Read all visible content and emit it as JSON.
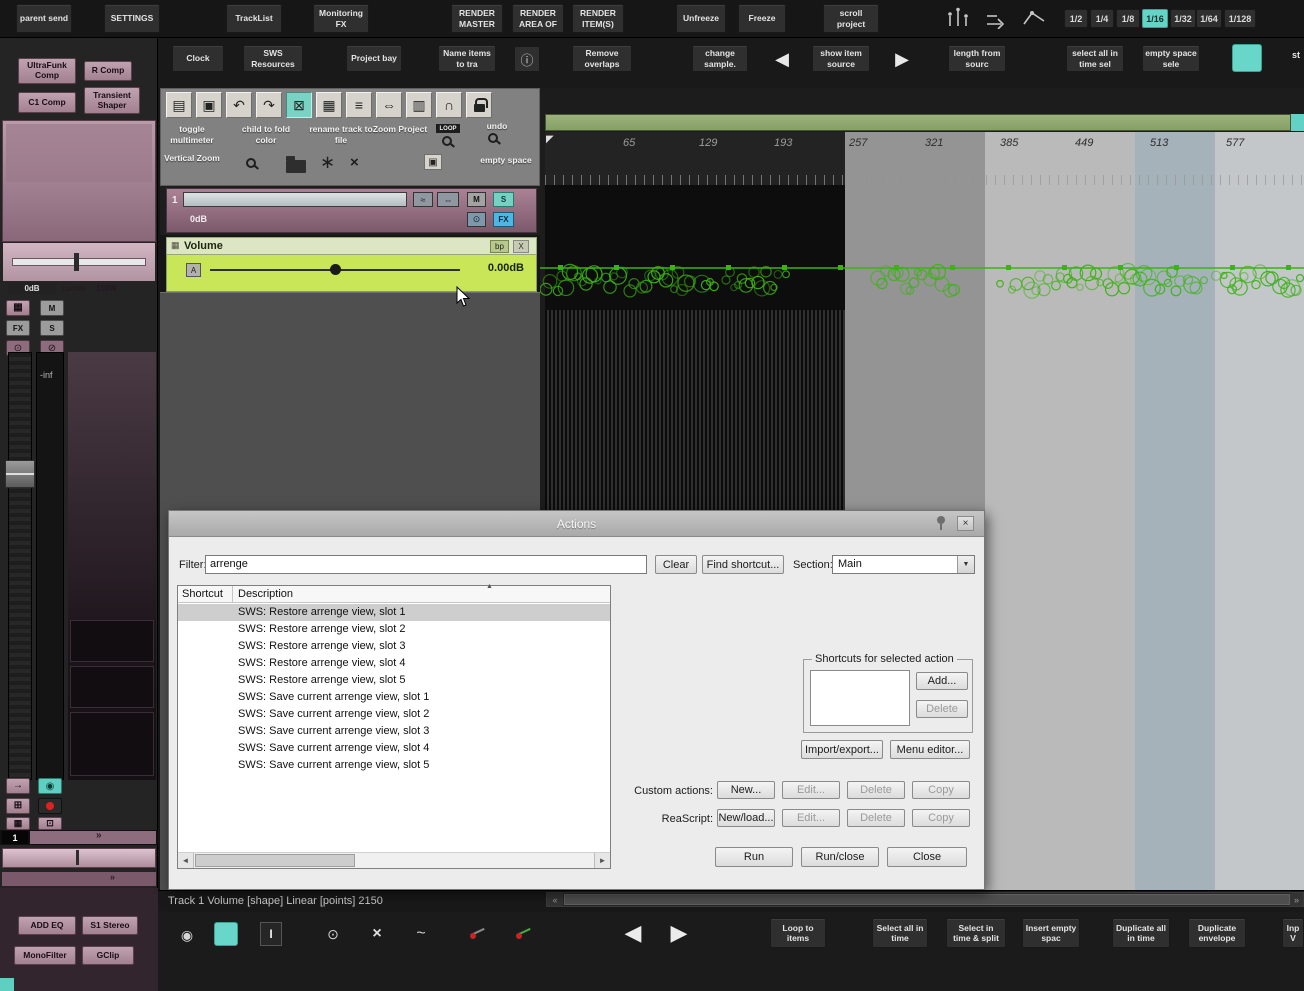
{
  "colors": {
    "accent_teal": "#67d3c6",
    "waveform_green": "#3cb313",
    "envelope_yellow_green": "#c9e558",
    "mixer_pink": "#b193a1"
  },
  "top_toolbar": {
    "buttons": [
      "parent send",
      "SETTINGS",
      "TrackList",
      "Monitoring FX",
      "RENDER MASTER",
      "RENDER AREA OF",
      "RENDER ITEM(S)",
      "Unfreeze",
      "Freeze",
      "scroll project"
    ],
    "grid_divisions": [
      "1/2",
      "1/4",
      "1/8",
      "1/16",
      "1/32",
      "1/64",
      "1/128"
    ],
    "active_division": "1/16"
  },
  "toolbar2": {
    "buttons": [
      "Clock",
      "SWS Resources",
      "Project bay",
      "Name items to tra",
      "Remove overlaps",
      "change sample.",
      "show item source",
      "length from sourc",
      "select all in time sel",
      "empty space sele"
    ],
    "partial_right": "st"
  },
  "mixer": {
    "fx_top": [
      "UltraFunk Comp",
      "R Comp",
      "C1 Comp",
      "Transient Shaper"
    ],
    "volume": "0dB",
    "pan": "center",
    "width": "100W",
    "mute": "M",
    "solo": "S",
    "fx": "FX",
    "meter": "-inf",
    "track_number": "1",
    "more": "»",
    "fx_bottom": [
      "ADD EQ",
      "S1 Stereo",
      "MonoFilter",
      "GClip"
    ]
  },
  "mid_toolbar": {
    "labels": [
      "toggle multimeter",
      "child to fold color",
      "rename track to file",
      "Zoom Project"
    ],
    "loop_label": "LOOP",
    "undo_label": "undo",
    "vertical_zoom": "Vertical Zoom",
    "empty_space": "empty space"
  },
  "track_panel": {
    "number": "1",
    "volume": "0dB",
    "mute": "M",
    "solo": "S",
    "fx": "FX"
  },
  "envelope_panel": {
    "title": "Volume",
    "bypass": "bp",
    "close": "X",
    "mode": "A",
    "value": "0.00dB"
  },
  "timeline": {
    "ruler_ticks": [
      "65",
      "129",
      "193",
      "257",
      "321",
      "385",
      "449",
      "513",
      "577"
    ]
  },
  "actions_dialog": {
    "title": "Actions",
    "filter_label": "Filter:",
    "filter_value": "arrenge",
    "clear_button": "Clear",
    "find_shortcut_button": "Find shortcut...",
    "section_label": "Section:",
    "section_value": "Main",
    "columns": [
      "Shortcut",
      "Description"
    ],
    "rows": [
      "SWS: Restore arrenge view, slot 1",
      "SWS: Restore arrenge view, slot 2",
      "SWS: Restore arrenge view, slot 3",
      "SWS: Restore arrenge view, slot 4",
      "SWS: Restore arrenge view, slot 5",
      "SWS: Save current arrenge view, slot 1",
      "SWS: Save current arrenge view, slot 2",
      "SWS: Save current arrenge view, slot 3",
      "SWS: Save current arrenge view, slot 4",
      "SWS: Save current arrenge view, slot 5"
    ],
    "selected_row": 0,
    "shortcuts_group_title": "Shortcuts for selected action",
    "add_button": "Add...",
    "delete_button": "Delete",
    "import_export_button": "Import/export...",
    "menu_editor_button": "Menu editor...",
    "custom_actions_label": "Custom actions:",
    "new_button": "New...",
    "edit_button": "Edit...",
    "copy_button": "Copy",
    "reascript_label": "ReaScript:",
    "new_load_button": "New/load...",
    "run_button": "Run",
    "run_close_button": "Run/close",
    "close_button": "Close"
  },
  "status_bar": {
    "text": "Track 1 Volume [shape] Linear [points] 2150"
  },
  "bottom_toolbar": {
    "buttons": [
      "Loop to items",
      "Select all in time",
      "Select in time & split",
      "Insert empty spac",
      "Duplicate all in time",
      "Duplicate envelope"
    ],
    "partial_right": "Inp V"
  }
}
